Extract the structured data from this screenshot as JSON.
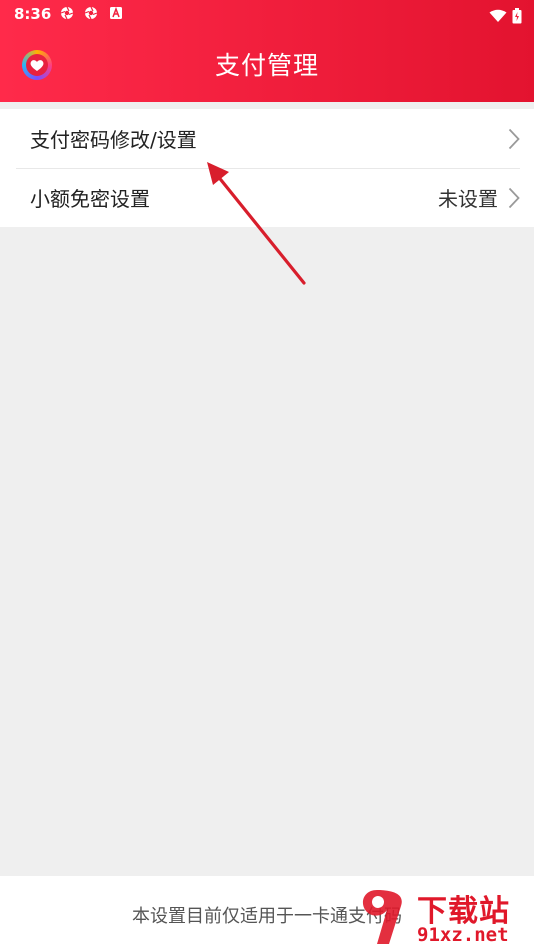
{
  "status_bar": {
    "time": "8:36",
    "icons": [
      "aperture-icon",
      "aperture-icon",
      "notification-a-icon"
    ],
    "right_icons": [
      "wifi-icon",
      "battery-icon"
    ]
  },
  "header": {
    "title": "支付管理",
    "logo_icon": "app-heart-logo",
    "colors": {
      "start": "#ff2a4a",
      "end": "#e3132f"
    }
  },
  "settings": [
    {
      "label": "支付密码修改/设置",
      "value": ""
    },
    {
      "label": "小额免密设置",
      "value": "未设置"
    }
  ],
  "footer": {
    "note": "本设置目前仅适用于一卡通支付码"
  },
  "watermark": {
    "top_text": "下载站",
    "bottom_text": "91xz.net"
  }
}
